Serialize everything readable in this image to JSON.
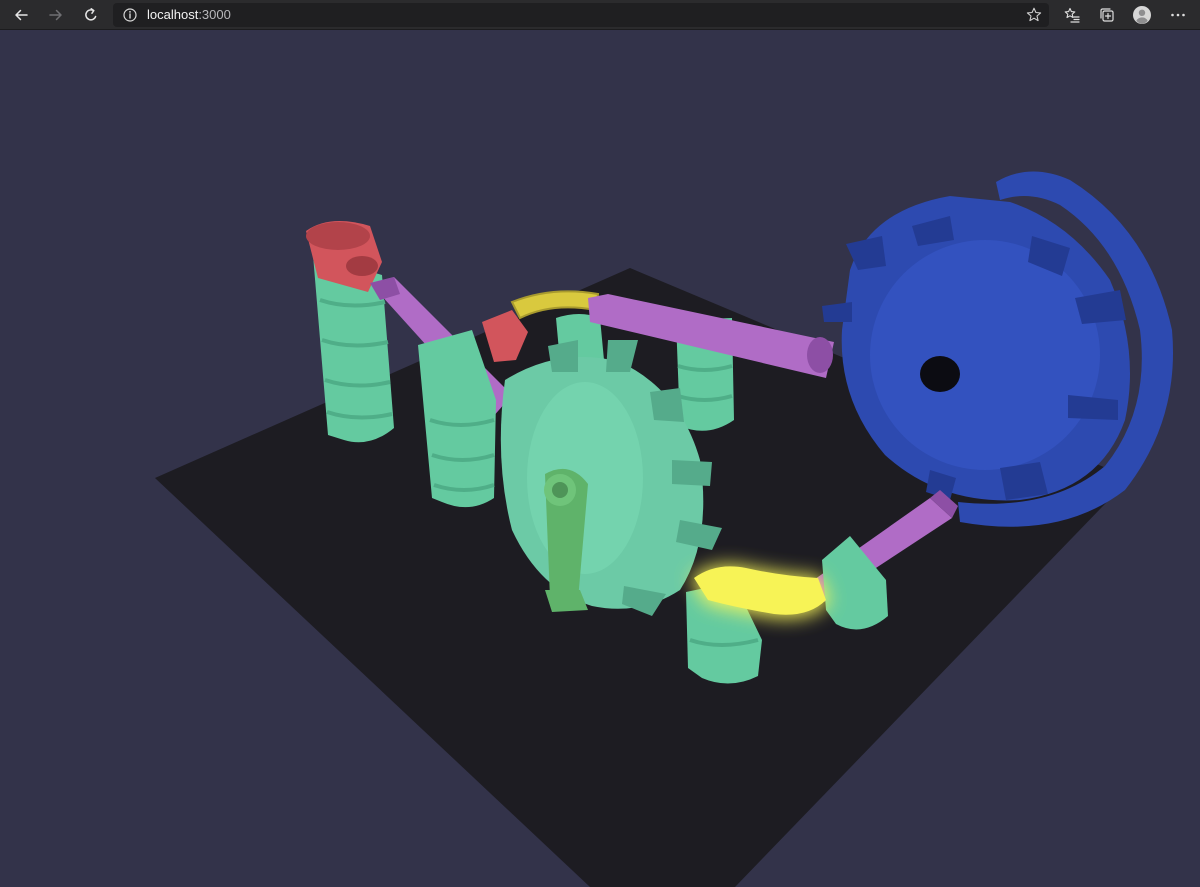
{
  "browser": {
    "url_host": "localhost",
    "url_port": ":3000",
    "icons": {
      "back": "arrow-left-icon",
      "forward": "arrow-right-icon",
      "reload": "reload-icon",
      "site_info": "info-icon",
      "favorite": "star-icon",
      "favorites_list": "favorites-icon",
      "collections": "collections-icon",
      "profile": "profile-icon",
      "menu": "more-icon"
    }
  },
  "scene": {
    "colors": {
      "background": "#33334a",
      "floor": "#1d1c22",
      "tower": "#64caa0",
      "tower_dark": "#4fae88",
      "track": "#b06cc6",
      "track_dark": "#8d4fa5",
      "gear_mint": "#6ccaa6",
      "gear_mint_dark": "#55ab8b",
      "gear_blue": "#2d4ab0",
      "gear_blue_dark": "#233b93",
      "start_cup": "#d2555c",
      "curve_yellow": "#d9c93e",
      "glow_yellow": "#fbf85a",
      "lever_green": "#5fb36a",
      "axle": "#0c0c12"
    }
  }
}
